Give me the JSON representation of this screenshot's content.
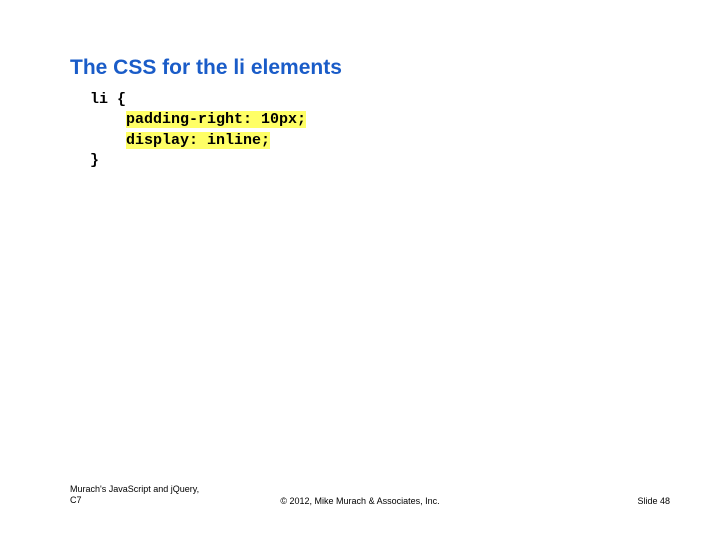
{
  "title": "The CSS for the li elements",
  "code": {
    "line1": "li {",
    "line2_indent": "    ",
    "line2_hi": "padding-right: 10px;",
    "line3_indent": "    ",
    "line3_hi": "display: inline;",
    "line4": "}"
  },
  "footer": {
    "left_line1": "Murach's JavaScript and jQuery,",
    "left_line2": "C7",
    "center": "© 2012, Mike Murach & Associates, Inc.",
    "right": "Slide 48"
  }
}
